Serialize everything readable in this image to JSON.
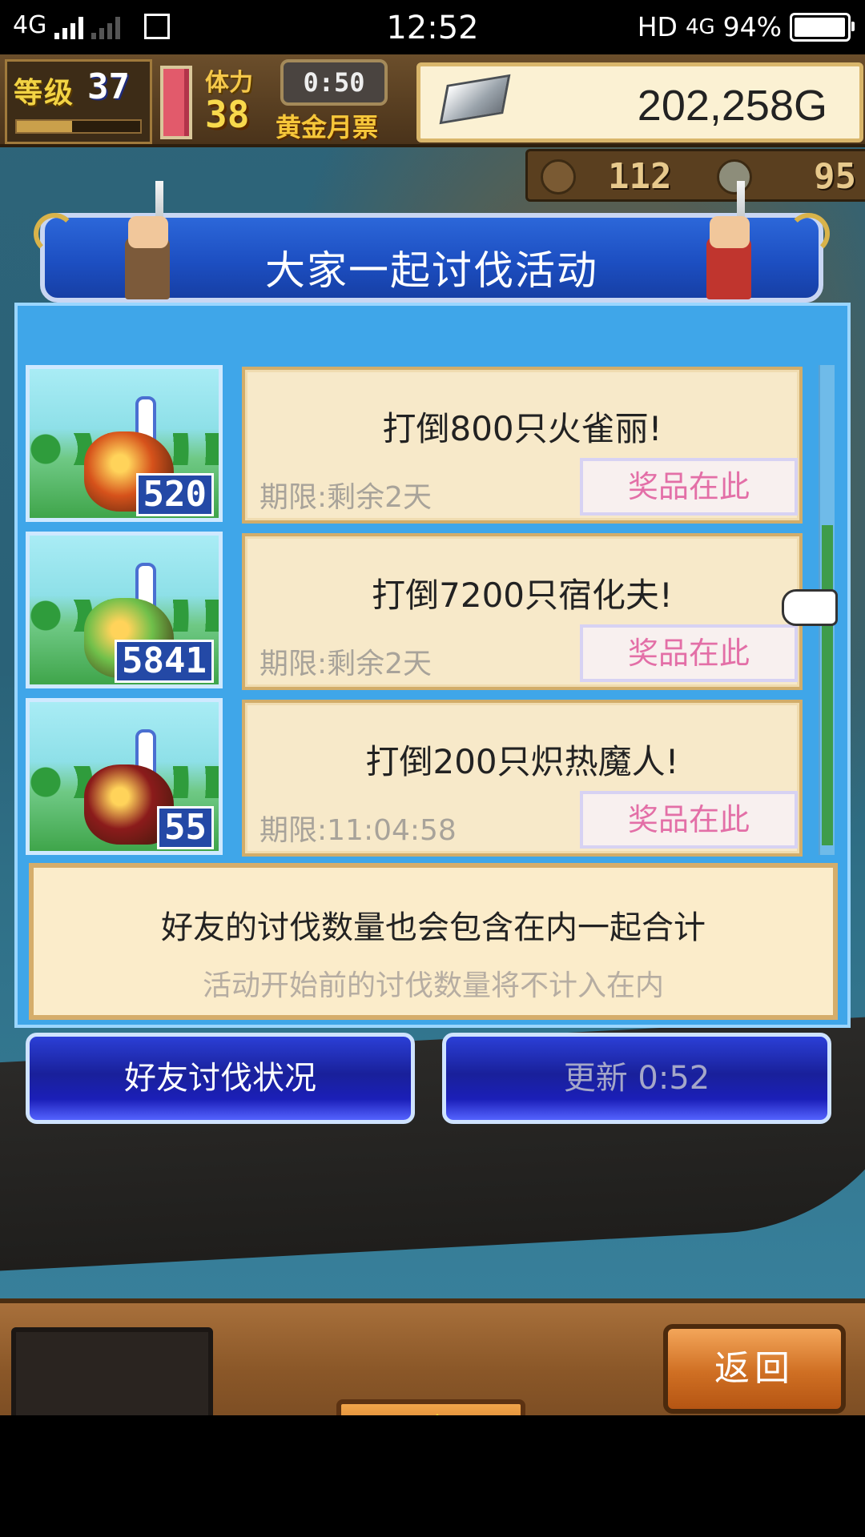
{
  "status_bar": {
    "network": "4G",
    "time": "12:52",
    "hd": "HD",
    "net2": "4G",
    "battery": "94%"
  },
  "hud": {
    "level_label": "等级",
    "level": "37",
    "stamina_label": "体力",
    "stamina": "38",
    "timer": "0:50",
    "gold_pass": "黄金月票",
    "money": "202,258G",
    "resource1": "112",
    "resource2": "95"
  },
  "panel": {
    "title": "大家一起讨伐活动",
    "events": [
      {
        "count": "520",
        "title": "打倒800只火雀丽!",
        "deadline": "期限:剩余2天",
        "prize": "奖品在此",
        "monster_color": "#d6521b"
      },
      {
        "count": "5841",
        "title": "打倒7200只宿化夫!",
        "deadline": "期限:剩余2天",
        "prize": "奖品在此",
        "monster_color": "#6fbf4a"
      },
      {
        "count": "55",
        "title": "打倒200只炽热魔人!",
        "deadline": "期限:11:04:58",
        "prize": "奖品在此",
        "monster_color": "#8b1b1b"
      }
    ],
    "note_main": "好友的讨伐数量也会包含在内一起合计",
    "note_sub": "活动开始前的讨伐数量将不计入在内",
    "friend_button": "好友讨伐状况",
    "refresh_button": "更新 0:52"
  },
  "dock": {
    "back": "返回"
  }
}
